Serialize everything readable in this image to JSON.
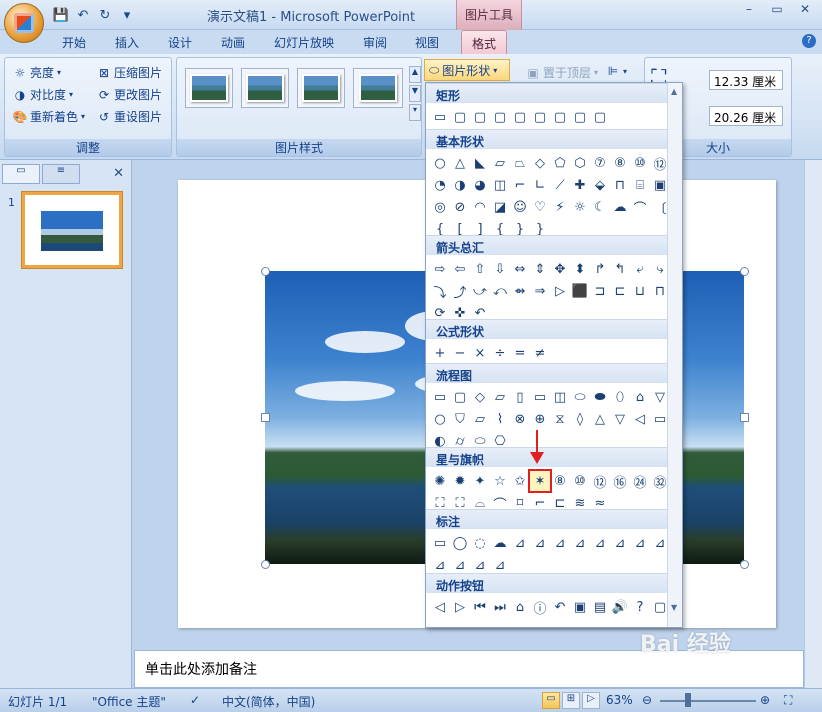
{
  "window": {
    "title": "演示文稿1 - Microsoft PowerPoint",
    "contextual_tab": "图片工具"
  },
  "tabs": [
    "开始",
    "插入",
    "设计",
    "动画",
    "幻灯片放映",
    "审阅",
    "视图",
    "格式"
  ],
  "active_tab": "格式",
  "ribbon": {
    "adjust": {
      "label": "调整",
      "items": [
        "亮度",
        "对比度",
        "重新着色",
        "压缩图片",
        "更改图片",
        "重设图片"
      ]
    },
    "picture_styles": {
      "label": "图片样式"
    },
    "picture_shape_button": "图片形状",
    "bring_front": "置于顶层",
    "size": {
      "label": "大小",
      "height": "12.33 厘米",
      "width": "20.26 厘米"
    }
  },
  "shape_menu": {
    "sections": [
      "矩形",
      "基本形状",
      "箭头总汇",
      "公式形状",
      "流程图",
      "星与旗帜",
      "标注",
      "动作按钮"
    ],
    "rows": {
      "rect": [
        "▭",
        "▢",
        "▢",
        "▢",
        "▢",
        "▢",
        "▢",
        "▢",
        "▢"
      ],
      "basic1": [
        "○",
        "△",
        "◣",
        "▱",
        "⏢",
        "◇",
        "⬠",
        "⬡",
        "⑦",
        "⑧",
        "⑩",
        "⑫"
      ],
      "basic2": [
        "◔",
        "◑",
        "◕",
        "◫",
        "⌐",
        "∟",
        "⟋",
        "✚",
        "⬙",
        "⊓",
        "⌸",
        "▣"
      ],
      "basic3": [
        "◎",
        "⊘",
        "◠",
        "◪",
        "☺",
        "♡",
        "⚡",
        "☼",
        "☾",
        "☁",
        "⌒",
        "〔"
      ],
      "basic4": [
        "{",
        "[",
        "]",
        "{",
        "}",
        "}"
      ],
      "arrows1": [
        "⇨",
        "⇦",
        "⇧",
        "⇩",
        "⇔",
        "⇕",
        "✥",
        "⬍",
        "↱",
        "↰",
        "⤶",
        "⤷"
      ],
      "arrows2": [
        "⤵",
        "⤴",
        "⤻",
        "⤺",
        "⇴",
        "⇒",
        "▷",
        "⬛",
        "⊐",
        "⊏",
        "⊔",
        "⊓"
      ],
      "arrows3": [
        "⟳",
        "✜",
        "↶"
      ],
      "formula": [
        "+",
        "−",
        "×",
        "÷",
        "=",
        "≠"
      ],
      "flow1": [
        "▭",
        "▢",
        "◇",
        "▱",
        "▯",
        "▭",
        "◫",
        "⬭",
        "⬬",
        "⬯",
        "⌂",
        "▽"
      ],
      "flow2": [
        "○",
        "⛉",
        "⏥",
        "⌇",
        "⊗",
        "⊕",
        "⧖",
        "◊",
        "△",
        "▽",
        "◁",
        "▭"
      ],
      "flow3": [
        "◐",
        "⌭",
        "⬭",
        "⎔"
      ],
      "stars1": [
        "✺",
        "✹",
        "✦",
        "☆",
        "✩",
        "✶",
        "⑧",
        "⑩",
        "⑫",
        "⑯",
        "㉔",
        "㉜"
      ],
      "stars2": [
        "⛶",
        "⛶",
        "⌓",
        "⌒",
        "⌑",
        "⌐",
        "⊏",
        "≋",
        "≈"
      ],
      "callouts": [
        "▭",
        "◯",
        "◌",
        "☁",
        "⊿",
        "⊿",
        "⊿",
        "⊿",
        "⊿",
        "⊿",
        "⊿",
        "⊿"
      ],
      "callouts2": [
        "⊿",
        "⊿",
        "⊿",
        "⊿"
      ],
      "actions": [
        "◁",
        "▷",
        "⏮",
        "⏭",
        "⌂",
        "ⓘ",
        "↶",
        "▣",
        "▤",
        "🔊",
        "?",
        "▢"
      ]
    },
    "highlighted_shape": "星形七角"
  },
  "slide_panel": {
    "slide_number": "1"
  },
  "notes": {
    "placeholder": "单击此处添加备注"
  },
  "status": {
    "slide": "幻灯片 1/1",
    "theme": "\"Office 主题\"",
    "language": "中文(简体，中国)",
    "zoom": "63%"
  },
  "watermark": "Bai 经验"
}
